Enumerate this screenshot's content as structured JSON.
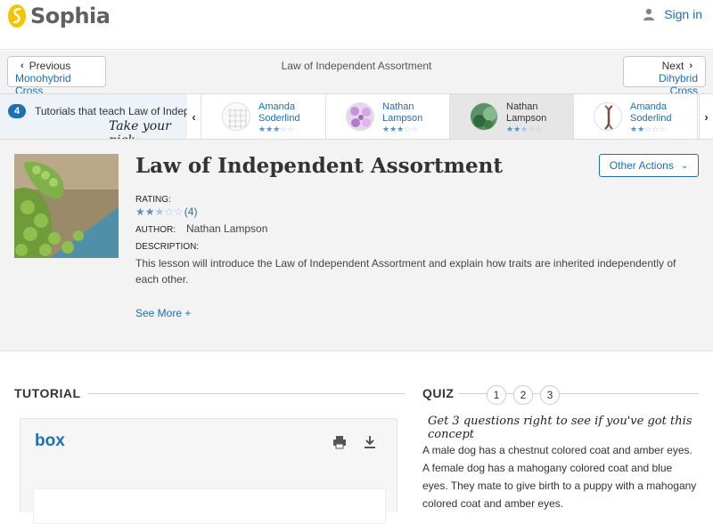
{
  "header": {
    "brand": "Sophia",
    "signin_label": "Sign in",
    "brand_color": "#f4c400"
  },
  "nav": {
    "prev_dir": "Previous",
    "prev_dest": "Monohybrid Cross",
    "title": "Law of Independent Assortment",
    "next_dir": "Next",
    "next_dest": "Dihybrid Cross"
  },
  "tutorials": {
    "count": "4",
    "label": "Tutorials that teach Law of Independent Assortment",
    "pick": "Take your pick:",
    "cards": [
      {
        "first": "Amanda",
        "last": "Soderlind",
        "rating": 3
      },
      {
        "first": "Nathan",
        "last": "Lampson",
        "rating": 3
      },
      {
        "first": "Nathan",
        "last": "Lampson",
        "rating": 2.5
      },
      {
        "first": "Amanda",
        "last": "Soderlind",
        "rating": 2
      }
    ]
  },
  "lesson": {
    "title": "Law of Independent Assortment",
    "actions_label": "Other Actions",
    "rating_label": "RATING:",
    "rating_value": 2.5,
    "rating_count": "(4)",
    "author_label": "AUTHOR:",
    "author_name": "Nathan Lampson",
    "description_label": "DESCRIPTION:",
    "description": "This lesson will introduce the Law of Independent Assortment and explain how traits are inherited independently of each other.",
    "see_more": "See More +"
  },
  "tutorial_section": {
    "heading": "TUTORIAL",
    "viewer_brand": "box"
  },
  "quiz": {
    "heading": "QUIZ",
    "steps": [
      "1",
      "2",
      "3"
    ],
    "subtitle": "Get 3 questions right to see if you've got this concept",
    "question": "A male dog has a chestnut colored coat and amber eyes. A female dog has a mahogany colored coat and blue eyes. They mate to give birth to a puppy with a mahogany colored coat and amber eyes."
  }
}
